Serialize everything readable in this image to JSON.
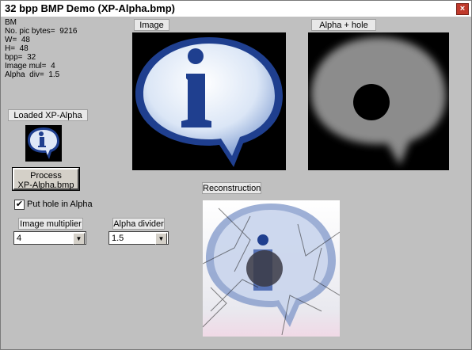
{
  "window": {
    "title": "32 bpp BMP Demo (XP-Alpha.bmp)",
    "close_glyph": "×"
  },
  "info_lines": [
    "BM",
    "No. pic bytes=  9216",
    "W=  48",
    "H=  48",
    "bpp=  32",
    "Image mul=  4",
    "Alpha  div=  1.5"
  ],
  "labels": {
    "image": "Image",
    "alpha_hole": "Alpha + hole",
    "loaded": "Loaded XP-Alpha",
    "reconstruction": "Reconstruction",
    "image_multiplier": "Image multiplier",
    "alpha_divider": "Alpha divider"
  },
  "process_button": {
    "line1": "Process",
    "line2": "XP-Alpha.bmp"
  },
  "hole_checkbox": {
    "label": "Put hole in Alpha",
    "checked": true,
    "glyph": "✔"
  },
  "image_multiplier_select": {
    "value": "4"
  },
  "alpha_divider_select": {
    "value": "1.5"
  },
  "icons": {
    "dropdown_arrow": "▼"
  },
  "colors": {
    "window_bg": "#c0c0c0",
    "icon_blue": "#1f3f8f",
    "bubble_light": "#dfe8f7",
    "alpha_gray": "#8c8c8c"
  }
}
